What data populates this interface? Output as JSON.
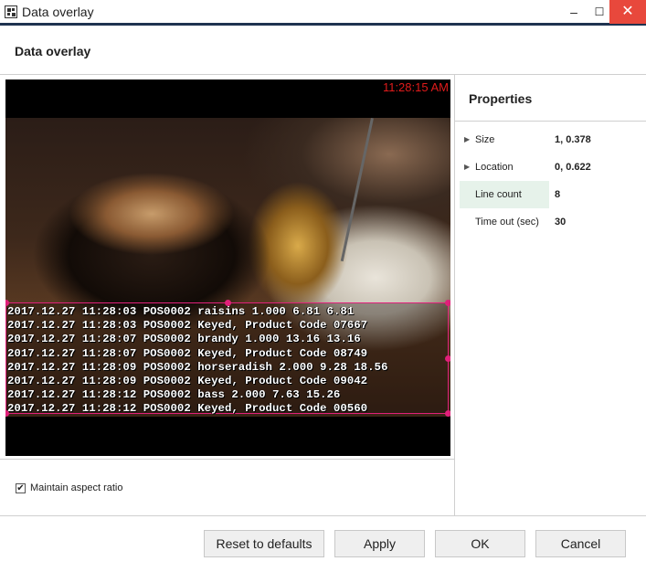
{
  "window": {
    "title": "Data overlay",
    "controls": {
      "minimize": "–",
      "maximize": "☐",
      "close": "✕"
    }
  },
  "header": {
    "title": "Data overlay"
  },
  "preview": {
    "time": "11:28:15 AM",
    "lines": [
      "2017.12.27 11:28:03 POS0002 raisins 1.000 6.81 6.81",
      "2017.12.27 11:28:03 POS0002 Keyed, Product Code 07667",
      "2017.12.27 11:28:07 POS0002 brandy 1.000 13.16 13.16",
      "2017.12.27 11:28:07 POS0002 Keyed, Product Code 08749",
      "2017.12.27 11:28:09 POS0002 horseradish 2.000 9.28 18.56",
      "2017.12.27 11:28:09 POS0002 Keyed, Product Code 09042",
      "2017.12.27 11:28:12 POS0002 bass 2.000 7.63 15.26",
      "2017.12.27 11:28:12 POS0002 Keyed, Product Code 00560"
    ],
    "overlay_color": "#e0207a",
    "time_color": "#e01b1b"
  },
  "aspect": {
    "label": "Maintain aspect ratio",
    "checked": true,
    "check_glyph": "✔"
  },
  "properties": {
    "title": "Properties",
    "rows": [
      {
        "name": "Size",
        "value": "1, 0.378",
        "expandable": true
      },
      {
        "name": "Location",
        "value": "0, 0.622",
        "expandable": true
      },
      {
        "name": "Line count",
        "value": "8",
        "expandable": false,
        "selected": true
      },
      {
        "name": "Time out (sec)",
        "value": "30",
        "expandable": false
      }
    ],
    "expand_glyph": "▶"
  },
  "footer": {
    "reset_label": "Reset to defaults",
    "apply_label": "Apply",
    "ok_label": "OK",
    "cancel_label": "Cancel"
  },
  "colors": {
    "titlebar_accent": "#1f3350",
    "close_button": "#e8483c",
    "selected_row": "#e6f2ea"
  }
}
